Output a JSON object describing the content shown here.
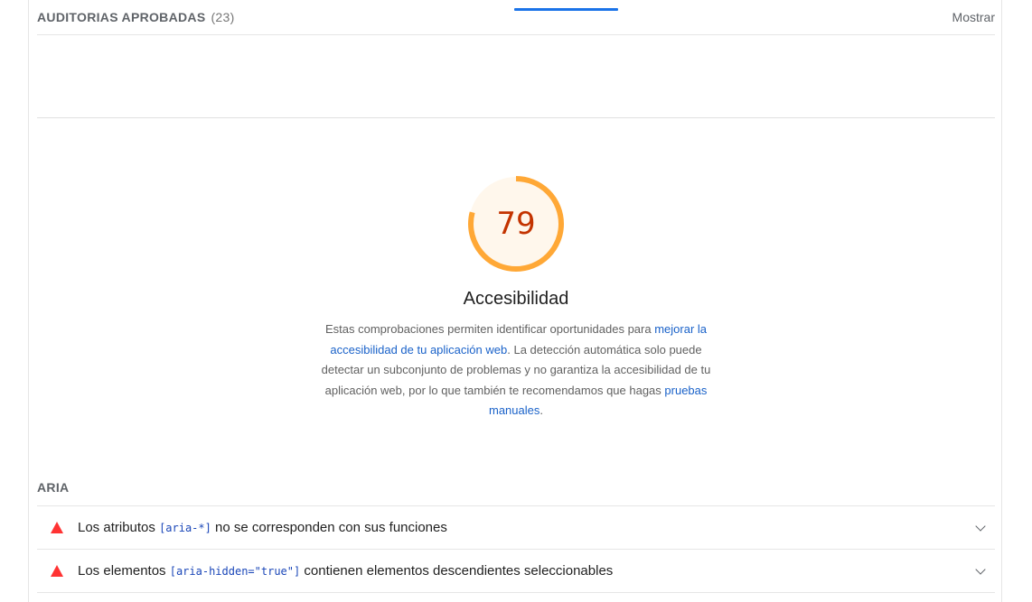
{
  "passed_audits": {
    "title": "AUDITORIAS APROBADAS",
    "count": "(23)",
    "show_label": "Mostrar"
  },
  "category": {
    "score": "79",
    "score_fraction": 0.79,
    "title": "Accesibilidad",
    "description": {
      "part1": "Estas comprobaciones permiten identificar oportunidades para ",
      "link1": "mejorar la accesibilidad de tu aplicación web",
      "part2": ". La detección automática solo puede detectar un subconjunto de problemas y no garantiza la accesibilidad de tu aplicación web, por lo que también te recomendamos que hagas ",
      "link2": "pruebas manuales",
      "part3": "."
    },
    "colors": {
      "gauge_arc": "#ffa836",
      "gauge_fill": "#fff7ec",
      "score_text": "#c33300",
      "accent": "#1a73e8",
      "link": "#1a62c9",
      "fail": "#ff3333"
    }
  },
  "group": {
    "title": "ARIA",
    "audits": [
      {
        "text_before": "Los atributos ",
        "code": "[aria-*]",
        "text_after": " no se corresponden con sus funciones",
        "icon": "fail-triangle-icon"
      },
      {
        "text_before": "Los elementos ",
        "code": "[aria-hidden=\"true\"]",
        "text_after": " contienen elementos descendientes seleccionables",
        "icon": "fail-triangle-icon"
      }
    ]
  }
}
